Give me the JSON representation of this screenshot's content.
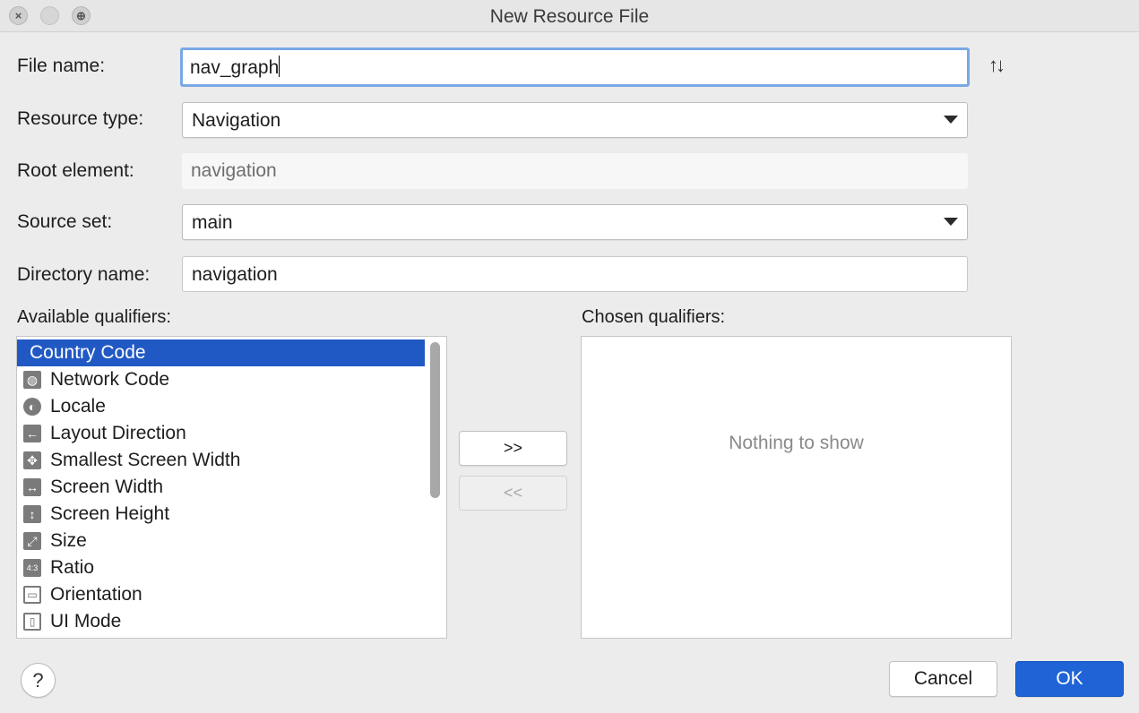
{
  "window": {
    "title": "New Resource File",
    "controls": {
      "close": "×",
      "zoom": "⊕"
    }
  },
  "form": {
    "file_name": {
      "label": "File name:",
      "value": "nav_graph"
    },
    "resource_type": {
      "label": "Resource type:",
      "value": "Navigation"
    },
    "root_element": {
      "label": "Root element:",
      "value": "navigation"
    },
    "source_set": {
      "label": "Source set:",
      "value": "main"
    },
    "directory_name": {
      "label": "Directory name:",
      "value": "navigation"
    },
    "sort_icon": "↑↓"
  },
  "available": {
    "label": "Available qualifiers:",
    "items": [
      {
        "label": "Country Code",
        "icon": "country-code-icon",
        "glyph": "",
        "selected": true
      },
      {
        "label": "Network Code",
        "icon": "network-code-icon",
        "glyph": "◍"
      },
      {
        "label": "Locale",
        "icon": "globe-icon",
        "glyph": "◐"
      },
      {
        "label": "Layout Direction",
        "icon": "layout-direction-icon",
        "glyph": "←"
      },
      {
        "label": "Smallest Screen Width",
        "icon": "smallest-screen-width-icon",
        "glyph": "✥"
      },
      {
        "label": "Screen Width",
        "icon": "screen-width-icon",
        "glyph": "↔"
      },
      {
        "label": "Screen Height",
        "icon": "screen-height-icon",
        "glyph": "↕"
      },
      {
        "label": "Size",
        "icon": "size-icon",
        "glyph": "⤢"
      },
      {
        "label": "Ratio",
        "icon": "ratio-icon",
        "glyph": "4:3"
      },
      {
        "label": "Orientation",
        "icon": "orientation-icon",
        "glyph": "▭"
      },
      {
        "label": "UI Mode",
        "icon": "ui-mode-icon",
        "glyph": "▯"
      }
    ]
  },
  "buttons": {
    "add": ">>",
    "remove": "<<",
    "help": "?",
    "cancel": "Cancel",
    "ok": "OK"
  },
  "chosen": {
    "label": "Chosen qualifiers:",
    "empty_text": "Nothing to show"
  }
}
